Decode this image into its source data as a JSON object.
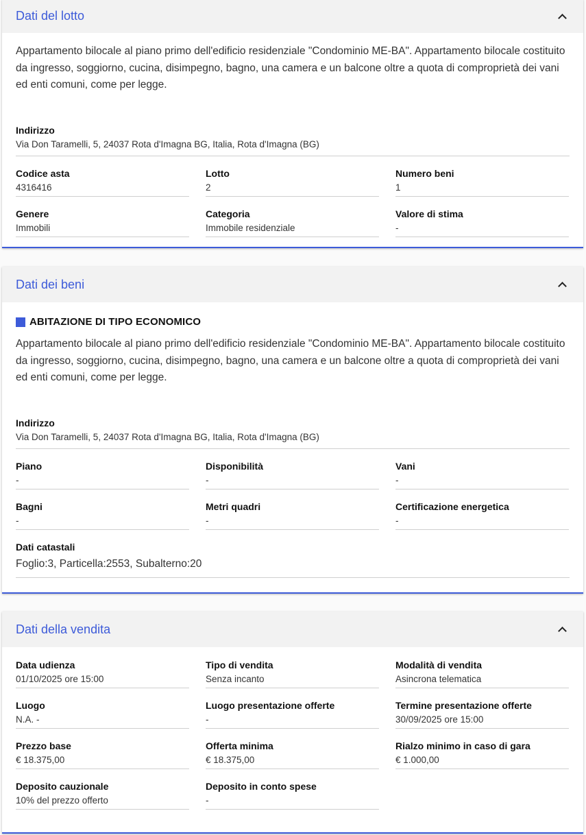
{
  "lotto": {
    "title": "Dati del lotto",
    "description": "Appartamento bilocale al piano primo dell'edificio residenziale \"Condominio ME-BA\". Appartamento bilocale costituito da ingresso, soggiorno, cucina, disimpegno, bagno, una camera e un balcone oltre a quota di comproprietà dei vani ed enti comuni, come per legge.",
    "indirizzo_label": "Indirizzo",
    "indirizzo_value": "Via Don Taramelli, 5, 24037 Rota d'Imagna BG, Italia, Rota d'Imagna (BG)",
    "fields": [
      {
        "label": "Codice asta",
        "value": "4316416"
      },
      {
        "label": "Lotto",
        "value": "2"
      },
      {
        "label": "Numero beni",
        "value": "1"
      },
      {
        "label": "Genere",
        "value": "Immobili"
      },
      {
        "label": "Categoria",
        "value": "Immobile residenziale"
      },
      {
        "label": "Valore di stima",
        "value": "-"
      }
    ]
  },
  "beni": {
    "title": "Dati dei beni",
    "bene_title": "ABITAZIONE DI TIPO ECONOMICO",
    "bene_color": "#3d5bd9",
    "description": "Appartamento bilocale al piano primo dell'edificio residenziale \"Condominio ME-BA\". Appartamento bilocale costituito da ingresso, soggiorno, cucina, disimpegno, bagno, una camera e un balcone oltre a quota di comproprietà dei vani ed enti comuni, come per legge.",
    "indirizzo_label": "Indirizzo",
    "indirizzo_value": "Via Don Taramelli, 5, 24037 Rota d'Imagna BG, Italia, Rota d'Imagna (BG)",
    "fields": [
      {
        "label": "Piano",
        "value": "-"
      },
      {
        "label": "Disponibilità",
        "value": "-"
      },
      {
        "label": "Vani",
        "value": "-"
      },
      {
        "label": "Bagni",
        "value": "-"
      },
      {
        "label": "Metri quadri",
        "value": "-"
      },
      {
        "label": "Certificazione energetica",
        "value": "-"
      }
    ],
    "catastali_label": "Dati catastali",
    "catastali_value": "Foglio:3, Particella:2553, Subalterno:20"
  },
  "vendita": {
    "title": "Dati della vendita",
    "fields": [
      {
        "label": "Data udienza",
        "value": "01/10/2025 ore 15:00"
      },
      {
        "label": "Tipo di vendita",
        "value": "Senza incanto"
      },
      {
        "label": "Modalità di vendita",
        "value": "Asincrona telematica"
      },
      {
        "label": "Luogo",
        "value": "N.A. -"
      },
      {
        "label": "Luogo presentazione offerte",
        "value": "-"
      },
      {
        "label": "Termine presentazione offerte",
        "value": "30/09/2025 ore 15:00"
      },
      {
        "label": "Prezzo base",
        "value": "€ 18.375,00"
      },
      {
        "label": "Offerta minima",
        "value": "€ 18.375,00"
      },
      {
        "label": "Rialzo minimo in caso di gara",
        "value": "€ 1.000,00"
      },
      {
        "label": "Deposito cauzionale",
        "value": "10% del prezzo offerto"
      },
      {
        "label": "Deposito in conto spese",
        "value": "-"
      }
    ]
  },
  "icons": {
    "collapse": "chevron-up-icon"
  },
  "colors": {
    "accent": "#3d5bd9",
    "header_bg": "#f2f2f2"
  }
}
